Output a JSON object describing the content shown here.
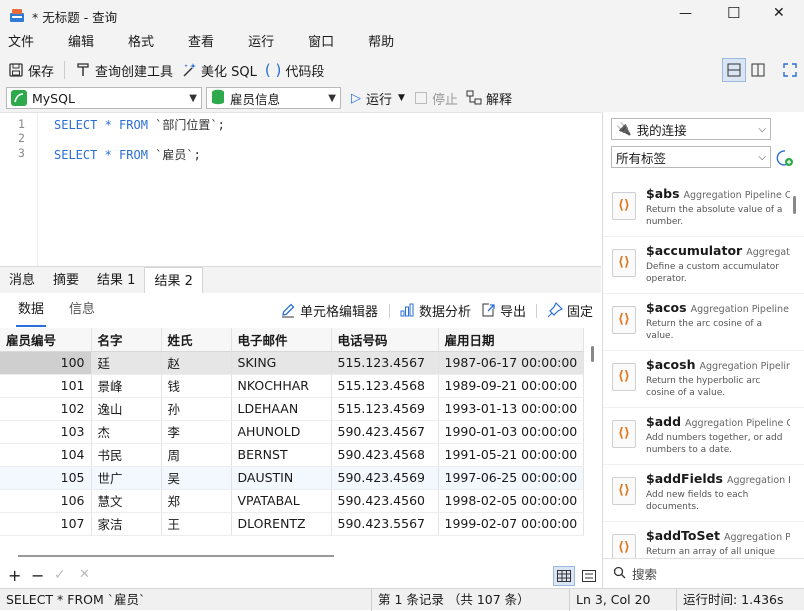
{
  "window": {
    "title": "* 无标题 - 查询",
    "minimize": "—",
    "maximize": "☐",
    "close": "✕"
  },
  "menu": [
    "文件",
    "编辑",
    "格式",
    "查看",
    "运行",
    "窗口",
    "帮助"
  ],
  "toolbar": {
    "save": "保存",
    "query_builder": "查询创建工具",
    "beautify": "美化 SQL",
    "snippet": "代码段"
  },
  "toolbar2": {
    "connection": "MySQL",
    "database": "雇员信息",
    "run": "运行",
    "stop": "停止",
    "explain": "解释"
  },
  "editor": {
    "lines": [
      {
        "num": "1",
        "kw": "SELECT * FROM",
        "rest": " `部门位置`;"
      },
      {
        "num": "2",
        "kw": "",
        "rest": ""
      },
      {
        "num": "3",
        "kw": "SELECT * FROM",
        "rest": " `雇员`;"
      }
    ]
  },
  "result_tabs": [
    "消息",
    "摘要",
    "结果 1",
    "结果 2"
  ],
  "data_toolbar": {
    "tab_data": "数据",
    "tab_info": "信息",
    "cell_editor": "单元格编辑器",
    "analysis": "数据分析",
    "export": "导出",
    "pin": "固定"
  },
  "grid": {
    "columns": [
      "雇员编号",
      "名字",
      "姓氏",
      "电子邮件",
      "电话号码",
      "雇用日期"
    ],
    "rows": [
      [
        "100",
        "廷",
        "赵",
        "SKING",
        "515.123.4567",
        "1987-06-17 00:00:00"
      ],
      [
        "101",
        "景峰",
        "钱",
        "NKOCHHAR",
        "515.123.4568",
        "1989-09-21 00:00:00"
      ],
      [
        "102",
        "逸山",
        "孙",
        "LDEHAAN",
        "515.123.4569",
        "1993-01-13 00:00:00"
      ],
      [
        "103",
        "杰",
        "李",
        "AHUNOLD",
        "590.423.4567",
        "1990-01-03 00:00:00"
      ],
      [
        "104",
        "书民",
        "周",
        "BERNST",
        "590.423.4568",
        "1991-05-21 00:00:00"
      ],
      [
        "105",
        "世广",
        "吴",
        "DAUSTIN",
        "590.423.4569",
        "1997-06-25 00:00:00"
      ],
      [
        "106",
        "慧文",
        "郑",
        "VPATABAL",
        "590.423.4560",
        "1998-02-05 00:00:00"
      ],
      [
        "107",
        "家洁",
        "王",
        "DLORENTZ",
        "590.423.5567",
        "1999-02-07 00:00:00"
      ]
    ]
  },
  "grid_footer": {
    "add": "+",
    "remove": "−",
    "apply": "✓",
    "discard": "✕"
  },
  "right_panel": {
    "connection_filter": "我的连接",
    "tag_filter": "所有标签",
    "search_placeholder": "搜索",
    "snippets": [
      {
        "name": "$abs",
        "category": "Aggregation Pipeline Operator",
        "desc": "Return the absolute value of a number."
      },
      {
        "name": "$accumulator",
        "category": "Aggregation Pipeline Operator",
        "desc": "Define a custom accumulator operator."
      },
      {
        "name": "$acos",
        "category": "Aggregation Pipeline Operator",
        "desc": "Return the arc cosine of a value."
      },
      {
        "name": "$acosh",
        "category": "Aggregation Pipeline Operator",
        "desc": "Return the hyperbolic arc cosine of a value."
      },
      {
        "name": "$add",
        "category": "Aggregation Pipeline Operator",
        "desc": "Add numbers together, or add numbers to a date."
      },
      {
        "name": "$addFields",
        "category": "Aggregation Pipeline Stage",
        "desc": "Add new fields to each documents."
      },
      {
        "name": "$addToSet",
        "category": "Aggregation Pipeline Operator",
        "desc": "Return an array of all unique values that results from applying an"
      }
    ]
  },
  "status": {
    "sql": "SELECT * FROM `雇员`",
    "records": "第 1 条记录 （共 107 条）",
    "position": "Ln 3, Col 20",
    "runtime": "运行时间: 1.436s"
  },
  "colors": {
    "accent": "#2a6fd6",
    "keyword": "#2a6fd6",
    "snippet_icon": "#e2761b"
  }
}
